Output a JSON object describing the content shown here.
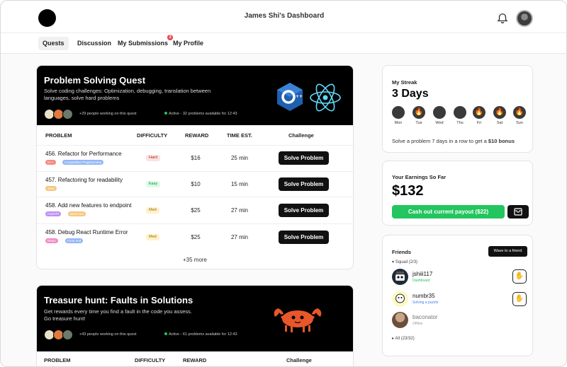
{
  "header": {
    "title": "James Shi's Dashboard"
  },
  "nav": {
    "tabs": [
      {
        "label": "Quests",
        "active": true
      },
      {
        "label": "Discussion"
      },
      {
        "label": "My Submissions",
        "badge": "3"
      },
      {
        "label": "My Profile"
      }
    ]
  },
  "quest1": {
    "title": "Problem Solving Quest",
    "description": "Solve coding challenges: Optimization, debugging, translation between languages, solve hard problems",
    "people_text": "+29 people working on this quest",
    "active_text": "Active - 32 problems available for 12:43",
    "logos": [
      "cpp-logo",
      "react-logo"
    ],
    "columns": [
      "PROBLEM",
      "DIFFICULTY",
      "REWARD",
      "TIME EST.",
      "Challenge"
    ],
    "rows": [
      {
        "name": "456. Refactor for Performance",
        "tags": [
          "C++",
          "Competitive Programming"
        ],
        "difficulty": "Hard",
        "reward": "$16",
        "time": "25 min",
        "action": "Solve Problem"
      },
      {
        "name": "457. Refactoring for readability",
        "tags": [
          "Java"
        ],
        "difficulty": "Easy",
        "reward": "$10",
        "time": "15 min",
        "action": "Solve Problem"
      },
      {
        "name": "458. Add new features to endpoint",
        "tags": [
          "FastAPI",
          "Back end"
        ],
        "difficulty": "Med",
        "reward": "$25",
        "time": "27 min",
        "action": "Solve Problem"
      },
      {
        "name": "458. Debug React Runtime Error",
        "tags": [
          "React",
          "Front end"
        ],
        "difficulty": "Med",
        "reward": "$25",
        "time": "27 min",
        "action": "Solve Problem"
      }
    ],
    "more": "+35 more"
  },
  "quest2": {
    "title": "Treasure hunt: Faults in Solutions",
    "description": "Get rewards every time you find a fault in the code you assess. Go treasure hunt!",
    "people_text": "+43 people working on this quest",
    "active_text": "Active - 61 problems available for 12:43",
    "columns": [
      "PROBLEM",
      "DIFFICULTY",
      "REWARD",
      "Challenge"
    ]
  },
  "streak": {
    "title": "My Streak",
    "value": "3 Days",
    "days": [
      {
        "label": "Mon",
        "fire": false
      },
      {
        "label": "Tue",
        "fire": true
      },
      {
        "label": "Wed",
        "fire": false
      },
      {
        "label": "Thu",
        "fire": false
      },
      {
        "label": "Fri",
        "fire": true
      },
      {
        "label": "Sat",
        "fire": true
      },
      {
        "label": "Sun",
        "fire": true
      }
    ],
    "note_prefix": "Solve a problem 7 days in a row to get a",
    "note_bonus": "$10 bonus"
  },
  "earnings": {
    "title": "Your Earnings So Far",
    "value": "$132",
    "cashout_label": "Cash out current payout ($22)"
  },
  "friends": {
    "title": "Friends",
    "tooltip": "Wave to a friend",
    "squad_label": "Squad (2/3)",
    "list": [
      {
        "name": "jshiii117",
        "status": "Dashboard",
        "status_color": "#22c55e"
      },
      {
        "name": "numbr35",
        "status": "Solving a puzzle",
        "status_color": "#3b82f6"
      },
      {
        "name": "baconator",
        "status": "Offline",
        "status_color": "#999999"
      }
    ],
    "all_label": "All (23/32)"
  },
  "colors": {
    "accent_green": "#22c55e",
    "hard": "#fde2e2",
    "easy": "#dcfce7",
    "med": "#fef3c7",
    "tag_cpp": "#f28b82",
    "tag_comp": "#93b7f5",
    "tag_java": "#f5c77e",
    "tag_fastapi": "#c08ef5",
    "tag_backend": "#f5c77e",
    "tag_react": "#f28bc6",
    "tag_frontend": "#93b7f5"
  }
}
